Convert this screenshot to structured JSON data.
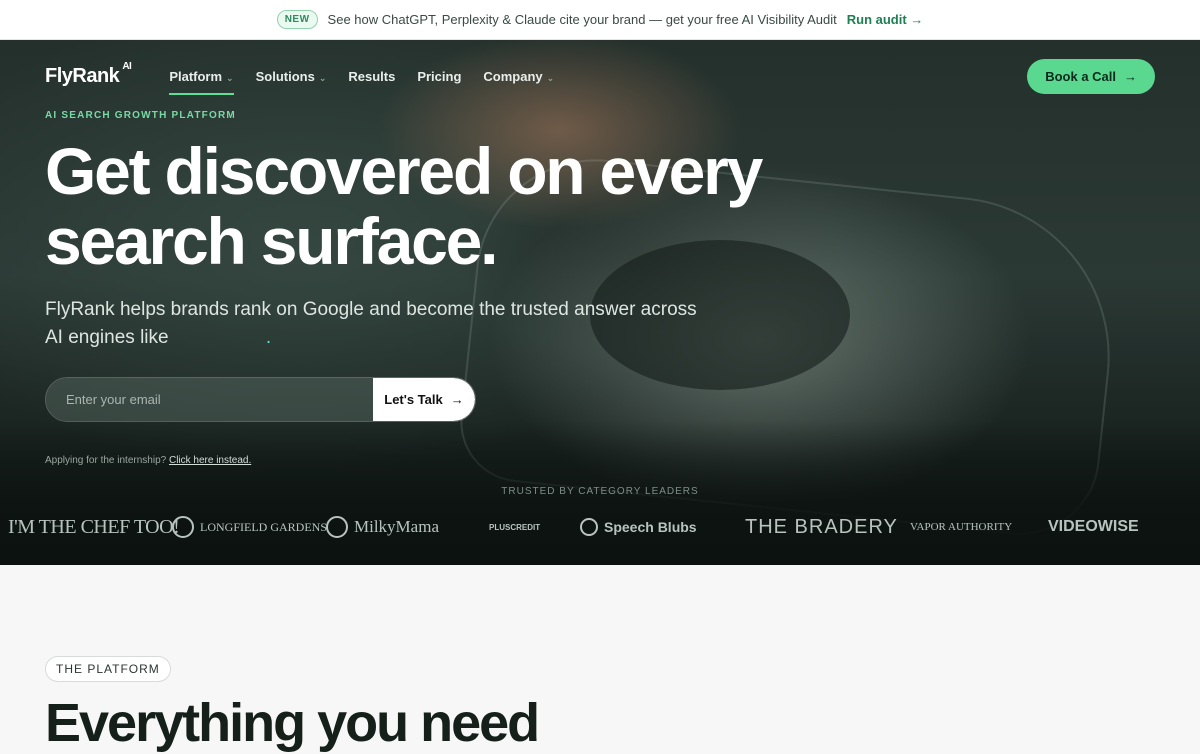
{
  "announcement": {
    "badge": "NEW",
    "text": "See how ChatGPT, Perplexity & Claude cite your brand — get your free AI Visibility Audit",
    "link": "Run audit →"
  },
  "nav": {
    "logo": "FlyRank",
    "logo_sup": "AI",
    "links": [
      {
        "label": "Platform",
        "chevron": "⌄"
      },
      {
        "label": "Solutions",
        "chevron": "⌄"
      },
      {
        "label": "Results"
      },
      {
        "label": "Pricing"
      },
      {
        "label": "Company",
        "chevron": "⌄"
      }
    ],
    "cta": "Book a Call",
    "cta_icon": "→"
  },
  "hero": {
    "eyebrow": "AI SEARCH GROWTH PLATFORM",
    "headline_line1": "Get discovered on every",
    "headline_line2": "search surface.",
    "sub_line1": "FlyRank helps brands rank on Google and become the trusted answer across",
    "sub_line2": "AI engines like",
    "email_placeholder": "Enter your email",
    "submit": "Let's Talk",
    "submit_icon": "→",
    "intern_prefix": "Applying for the internship?",
    "intern_link": "Click here instead."
  },
  "trusted": {
    "label": "TRUSTED BY CATEGORY LEADERS",
    "brands": [
      "I'M THE CHEF TOO!",
      "LONGFIELD GARDENS",
      "MilkyMama",
      "PLUSCREDIT",
      "Speech Blubs",
      "THE BRADERY",
      "VAPOR AUTHORITY",
      "VIDEOWISE"
    ]
  },
  "platform": {
    "pill": "THE PLATFORM",
    "title": "Everything you need"
  },
  "colors": {
    "accent": "#5ad88f",
    "hero_bg": "#24302c"
  }
}
